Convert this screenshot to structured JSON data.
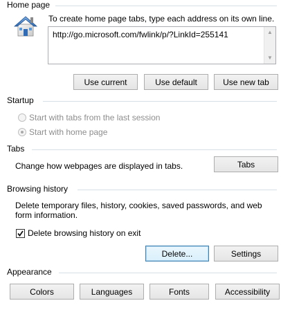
{
  "home_page": {
    "title": "Home page",
    "instructions": "To create home page tabs, type each address on its own line.",
    "url_value": "http://go.microsoft.com/fwlink/p/?LinkId=255141",
    "buttons": {
      "use_current": "Use current",
      "use_default": "Use default",
      "use_new_tab": "Use new tab"
    },
    "icon": "house-icon"
  },
  "startup": {
    "title": "Startup",
    "options": [
      {
        "label": "Start with tabs from the last session",
        "selected": false,
        "enabled": false
      },
      {
        "label": "Start with home page",
        "selected": true,
        "enabled": false
      }
    ]
  },
  "tabs": {
    "title": "Tabs",
    "description": "Change how webpages are displayed in tabs.",
    "button": "Tabs"
  },
  "browsing_history": {
    "title": "Browsing history",
    "description_line1": "Delete temporary files, history, cookies, saved passwords, and web",
    "description_line2": "form information.",
    "checkbox_label": "Delete browsing history on exit",
    "checkbox_checked": true,
    "buttons": {
      "delete": "Delete...",
      "settings": "Settings"
    }
  },
  "appearance": {
    "title": "Appearance",
    "buttons": {
      "colors": "Colors",
      "languages": "Languages",
      "fonts": "Fonts",
      "accessibility": "Accessibility"
    }
  },
  "colors": {
    "group_rule": "#d5dfe5",
    "accent_focus": "#3c7fb1",
    "disabled_text": "#8d8d8d"
  }
}
